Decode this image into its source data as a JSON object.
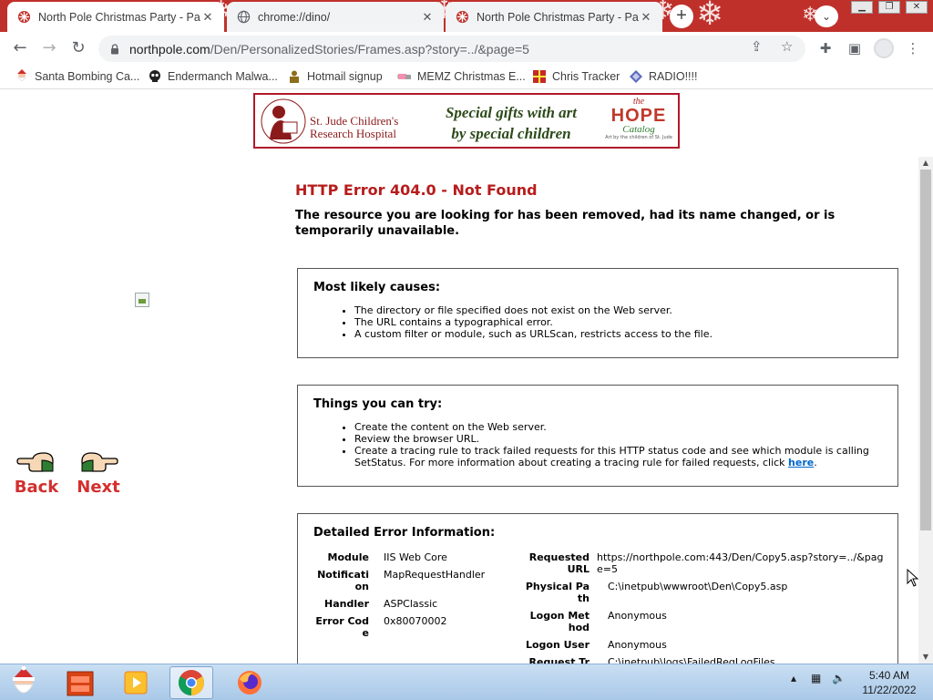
{
  "browser": {
    "tabs": [
      {
        "title": "North Pole Christmas Party - Pag",
        "active": true
      },
      {
        "title": "chrome://dino/",
        "active": false
      },
      {
        "title": "North Pole Christmas Party - Pag",
        "active": false
      }
    ],
    "new_tab_label": "+",
    "address": {
      "host": "northpole.com",
      "path": "/Den/PersonalizedStories/Frames.asp?story=../&page=5"
    },
    "bookmarks": [
      {
        "label": "Santa Bombing Ca...",
        "icon": "santa-icon"
      },
      {
        "label": "Endermanch Malwa...",
        "icon": "skull-icon"
      },
      {
        "label": "Hotmail signup",
        "icon": "person-icon"
      },
      {
        "label": "MEMZ Christmas E...",
        "icon": "nyan-icon"
      },
      {
        "label": "Chris Tracker",
        "icon": "gift-icon"
      },
      {
        "label": "RADIO!!!!",
        "icon": "diamond-icon"
      }
    ]
  },
  "page": {
    "banner": {
      "org_name_line1": "St. Jude Children's",
      "org_name_line2": "Research Hospital",
      "tagline_line1": "Special gifts with art",
      "tagline_line2": "by special children",
      "hope_the": "the",
      "hope_word": "HOPE",
      "hope_catalog": "Catalog",
      "hope_sub": "Art by the children of St. Jude"
    },
    "nav": {
      "back_label": "Back",
      "next_label": "Next"
    },
    "error": {
      "title": "HTTP Error 404.0 - Not Found",
      "description": "The resource you are looking for has been removed, had its name changed, or is temporarily unavailable.",
      "causes_heading": "Most likely causes:",
      "causes": [
        "The directory or file specified does not exist on the Web server.",
        "The URL contains a typographical error.",
        "A custom filter or module, such as URLScan, restricts access to the file."
      ],
      "try_heading": "Things you can try:",
      "try_items": [
        "Create the content on the Web server.",
        "Review the browser URL."
      ],
      "try_trace_text": "Create a tracing rule to track failed requests for this HTTP status code and see which module is calling SetStatus. For more information about creating a tracing rule for failed requests, click ",
      "try_trace_link": "here",
      "try_trace_end": ".",
      "detail_heading": "Detailed Error Information:",
      "detail_left": [
        {
          "key": "Module",
          "value": "IIS Web Core"
        },
        {
          "key": "Notification",
          "value": "MapRequestHandler"
        },
        {
          "key": "Handler",
          "value": "ASPClassic"
        },
        {
          "key": "Error Code",
          "value": "0x80070002"
        }
      ],
      "detail_right": [
        {
          "key": "Requested URL",
          "value": "https://northpole.com:443/Den/Copy5.asp?story=../&page=5"
        },
        {
          "key": "Physical Path",
          "value": "C:\\inetpub\\wwwroot\\Den\\Copy5.asp"
        },
        {
          "key": "Logon Method",
          "value": "Anonymous"
        },
        {
          "key": "Logon User",
          "value": "Anonymous"
        },
        {
          "key": "Request Tr",
          "value": "C:\\inetpub\\logs\\FailedReqLogFiles"
        }
      ]
    }
  },
  "taskbar": {
    "time": "5:40 AM",
    "date": "11/22/2022",
    "apps": [
      "santa-start-icon",
      "file-cabinet-icon",
      "media-player-icon",
      "chrome-icon",
      "firefox-icon"
    ]
  }
}
